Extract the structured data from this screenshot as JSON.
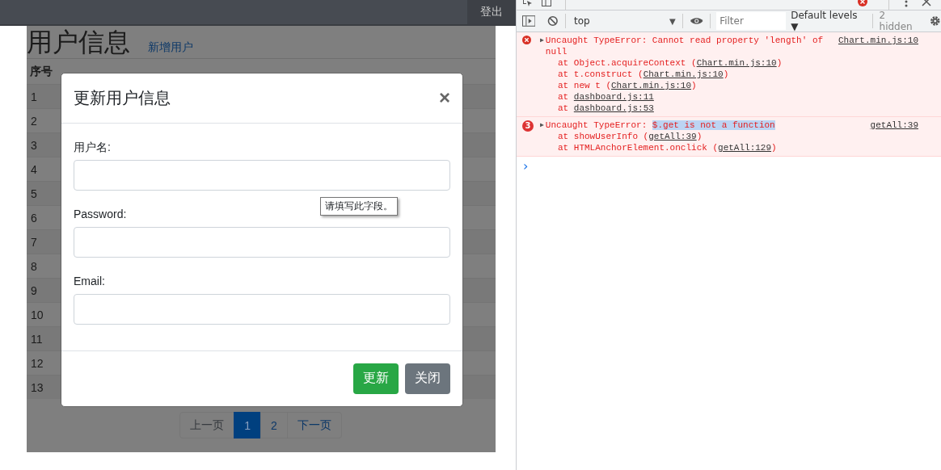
{
  "navbar": {
    "logout": "登出"
  },
  "page": {
    "title": "用户信息",
    "add_link": "新增用户",
    "table": {
      "columns": [
        "序号"
      ],
      "rows": [
        {
          "index": "1"
        },
        {
          "index": "2"
        },
        {
          "index": "3"
        },
        {
          "index": "4"
        },
        {
          "index": "5"
        },
        {
          "index": "6"
        },
        {
          "index": "7"
        },
        {
          "index": "8"
        },
        {
          "index": "9"
        },
        {
          "index": "10"
        },
        {
          "index": "11"
        },
        {
          "index": "12"
        },
        {
          "index": "13"
        }
      ]
    },
    "pagination": [
      {
        "label": "上一页",
        "selected": false,
        "disabled": true
      },
      {
        "label": "1",
        "selected": true,
        "disabled": false
      },
      {
        "label": "2",
        "selected": false,
        "disabled": false
      },
      {
        "label": "下一页",
        "selected": false,
        "disabled": false
      }
    ]
  },
  "modal": {
    "title": "更新用户信息",
    "close": "×",
    "fields": [
      {
        "label": "用户名:"
      },
      {
        "label": "Password:"
      },
      {
        "label": "Email:"
      }
    ],
    "tooltip": "请填写此字段。",
    "buttons": [
      {
        "label": "更新",
        "kind": "primary"
      },
      {
        "label": "关闭",
        "kind": "secondary"
      }
    ]
  },
  "devtools": {
    "toolbar": {
      "context": "top",
      "context_arrow": "▼",
      "filter_placeholder": "Filter",
      "levels": "Default levels ▼",
      "hidden": "2 hidden"
    },
    "messages": [
      {
        "kind": "error",
        "toggle": "▶",
        "text": "Uncaught TypeError: Cannot read property 'length' of null",
        "source": "Chart.min.js:10",
        "stack": [
          {
            "prefix": "at Object.acquireContext (",
            "link": "Chart.min.js:10",
            "suffix": ")"
          },
          {
            "prefix": "at t.construct (",
            "link": "Chart.min.js:10",
            "suffix": ")"
          },
          {
            "prefix": "at new t (",
            "link": "Chart.min.js:10",
            "suffix": ")"
          },
          {
            "prefix": "at ",
            "link": "dashboard.js:11"
          },
          {
            "prefix": "at ",
            "link": "dashboard.js:53"
          }
        ]
      },
      {
        "kind": "repeated",
        "count": "3",
        "toggle": "▶",
        "text": "Uncaught TypeError: ",
        "highlight": "$.get is not a function",
        "source": "getAll:39",
        "stack": [
          {
            "prefix": "at showUserInfo (",
            "link": "getAll:39",
            "suffix": ")"
          },
          {
            "prefix": "at HTMLAnchorElement.onclick (",
            "link": "getAll:129",
            "suffix": ")"
          }
        ]
      }
    ],
    "prompt": "›"
  }
}
